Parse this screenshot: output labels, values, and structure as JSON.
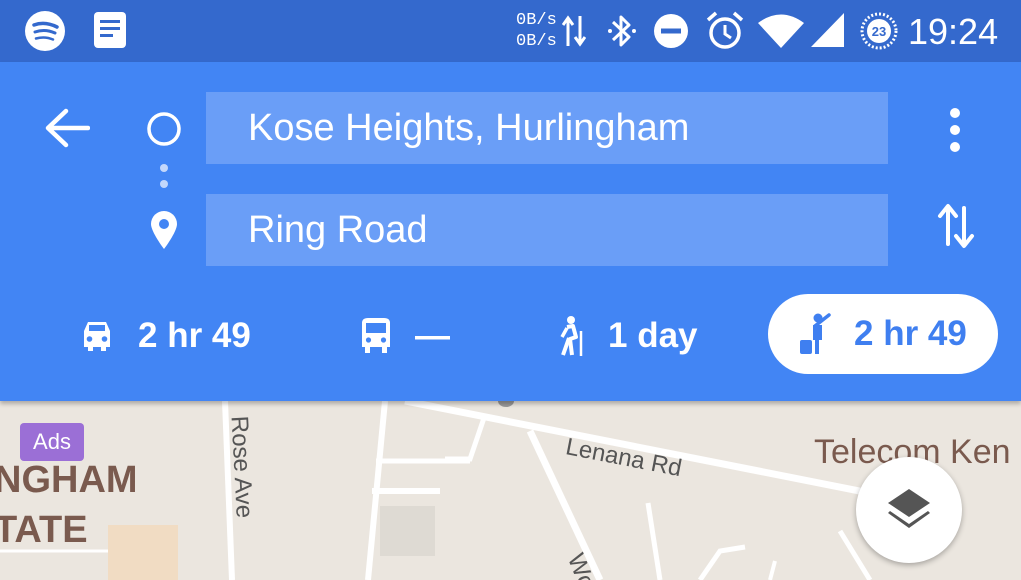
{
  "status_bar": {
    "net_up": "0B/s",
    "net_down": "0B/s",
    "time": "19:24",
    "data_saver_badge": "23",
    "icons": [
      "spotify-icon",
      "notes-icon",
      "data-transfer-icon",
      "bluetooth-icon",
      "do-not-disturb-icon",
      "alarm-icon",
      "wifi-icon",
      "cellular-icon",
      "data-saver-icon"
    ]
  },
  "directions": {
    "origin": "Kose Heights, Hurlingham",
    "destination": "Ring Road",
    "icons": [
      "back-arrow-icon",
      "origin-circle-icon",
      "route-dots-icon",
      "destination-pin-icon",
      "more-options-icon",
      "swap-icon"
    ]
  },
  "travel_modes": [
    {
      "mode": "drive",
      "icon": "car-icon",
      "label": "2 hr 49",
      "selected": false
    },
    {
      "mode": "transit",
      "icon": "bus-icon",
      "label": "—",
      "selected": false
    },
    {
      "mode": "walk",
      "icon": "walking-icon",
      "label": "1 day",
      "selected": false
    },
    {
      "mode": "ride",
      "icon": "ride-hailing-icon",
      "label": "2 hr 49",
      "selected": true
    }
  ],
  "map": {
    "ads_badge": "Ads",
    "place_label_line1": "NGHAM",
    "place_label_line2": "TATE",
    "road_rose_ave": "Rose Ave",
    "road_lenana": "Lenana Rd",
    "road_woo": "Woo",
    "poi_telecom": "Telecom Ken",
    "layers_icon": "layers-icon"
  },
  "colors": {
    "status_bar": "#3469cd",
    "header": "#4285f4",
    "field": "#6a9ef7",
    "selected_mode_text": "#3f7ff0",
    "ads_badge": "#9b6fd6",
    "map_background": "#ebe6df"
  }
}
